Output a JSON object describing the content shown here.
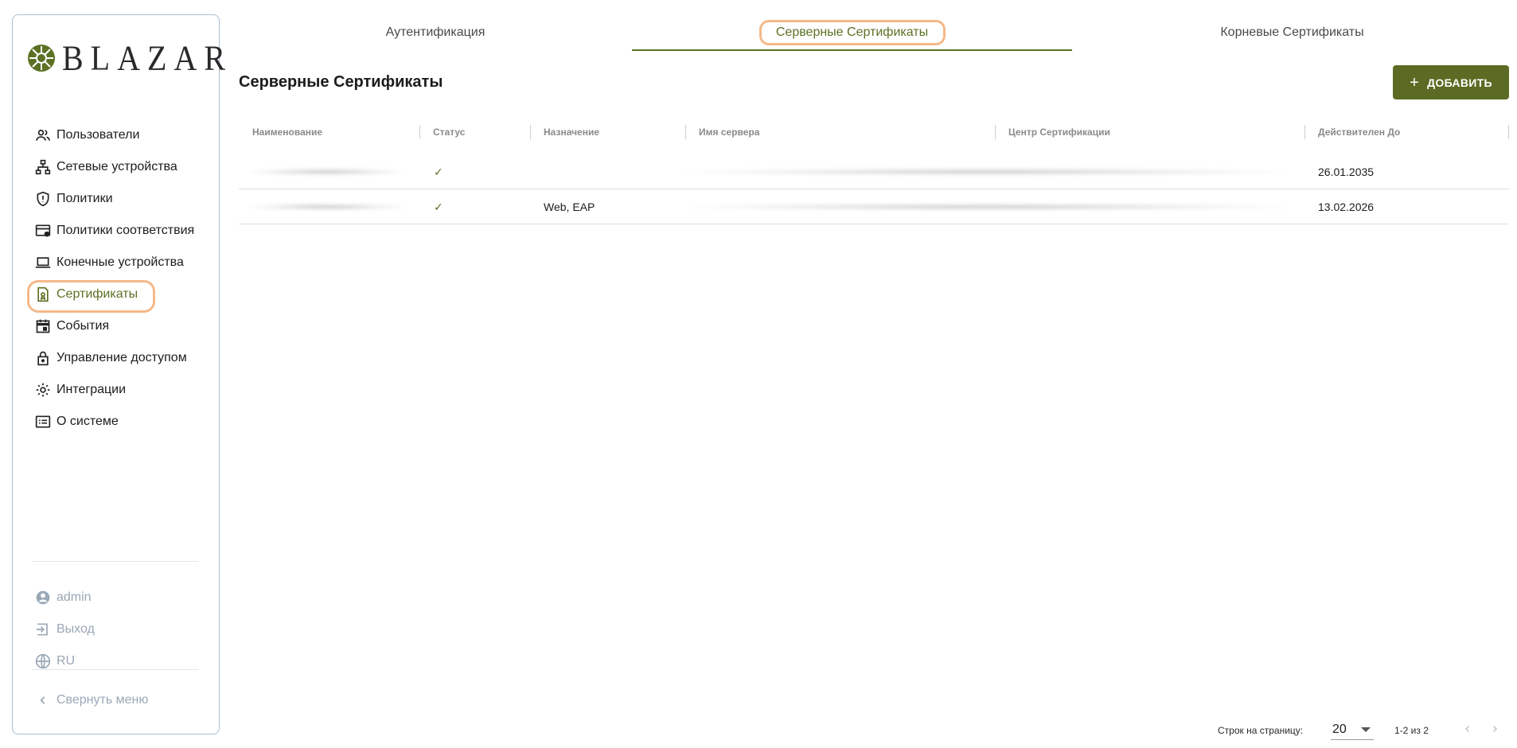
{
  "app": {
    "logo_text": "BLAZAR"
  },
  "sidebar": {
    "items": [
      {
        "label": "Пользователи",
        "icon": "users-icon"
      },
      {
        "label": "Сетевые устройства",
        "icon": "network-icon"
      },
      {
        "label": "Политики",
        "icon": "shield-icon"
      },
      {
        "label": "Политики соответствия",
        "icon": "card-check-icon"
      },
      {
        "label": "Конечные устройства",
        "icon": "laptop-icon"
      },
      {
        "label": "Сертификаты",
        "icon": "certificate-icon",
        "active": true
      },
      {
        "label": "События",
        "icon": "calendar-icon"
      },
      {
        "label": "Управление доступом",
        "icon": "lock-icon"
      },
      {
        "label": "Интеграции",
        "icon": "gear-icon"
      },
      {
        "label": "О системе",
        "icon": "info-card-icon"
      }
    ],
    "bottom": [
      {
        "label": "admin",
        "icon": "account-circle-icon"
      },
      {
        "label": "Выход",
        "icon": "logout-icon"
      },
      {
        "label": "RU",
        "icon": "globe-icon"
      }
    ],
    "collapse_label": "Свернуть меню"
  },
  "tabs": [
    {
      "label": "Аутентификация"
    },
    {
      "label": "Серверные Сертификаты",
      "active": true
    },
    {
      "label": "Корневые Сертификаты"
    }
  ],
  "main": {
    "title": "Серверные Сертификаты",
    "add_button_label": "ДОБАВИТЬ"
  },
  "table": {
    "columns": [
      "Наименование",
      "Статус",
      "Назначение",
      "Имя сервера",
      "Центр Сертификации",
      "Действителен До"
    ],
    "rows": [
      {
        "name": "",
        "status": "✓",
        "purpose": "",
        "server": "",
        "ca": "",
        "valid_until": "26.01.2035"
      },
      {
        "name": "",
        "status": "✓",
        "purpose": "Web, EAP",
        "server": "",
        "ca": "",
        "valid_until": "13.02.2026"
      }
    ]
  },
  "pagination": {
    "rows_per_page_label": "Строк на страницу:",
    "rows_per_page_value": "20",
    "range_label": "1-2 из 2"
  },
  "colors": {
    "accent": "#5c7124",
    "button": "#5c6b23",
    "highlight": "#f4b98a",
    "muted": "#9aa8b6"
  }
}
